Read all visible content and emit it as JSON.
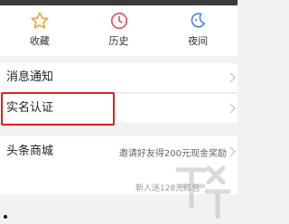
{
  "shortcuts": [
    {
      "label": "收藏",
      "icon": "star-icon"
    },
    {
      "label": "历史",
      "icon": "clock-icon"
    },
    {
      "label": "夜间",
      "icon": "moon-icon"
    }
  ],
  "menu": {
    "notifications": {
      "label": "消息通知"
    },
    "real_name": {
      "label": "实名认证"
    },
    "mall": {
      "label": "头条商城",
      "promo": "邀请好友得200元现金奖励",
      "sub": "新人送128元红包"
    }
  },
  "colors": {
    "highlight": "#e02020",
    "icon_orange": "#f0a33a",
    "icon_red": "#e8504b",
    "icon_blue": "#4a86e8"
  }
}
